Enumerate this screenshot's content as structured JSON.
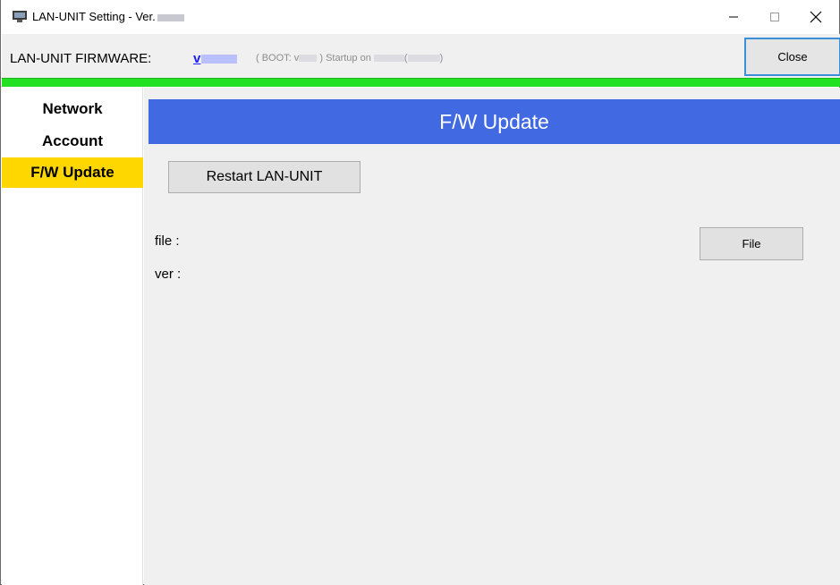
{
  "window": {
    "title": "LAN-UNIT Setting - Ver.",
    "minimize_glyph": "—",
    "maximize_glyph": "☐",
    "close_glyph": "✕"
  },
  "header": {
    "firmware_label": "LAN-UNIT FIRMWARE:",
    "firmware_version": "v",
    "boot_prefix": "( BOOT: v",
    "boot_suffix": ") Startup on",
    "boot_paren_open": "(",
    "boot_paren_close": ")",
    "close_label": "Close"
  },
  "sidebar": {
    "items": [
      {
        "label": "Network",
        "active": false
      },
      {
        "label": "Account",
        "active": false
      },
      {
        "label": "F/W Update",
        "active": true
      }
    ]
  },
  "main": {
    "title": "F/W Update",
    "restart_label": "Restart LAN-UNIT",
    "file_label": "file :",
    "ver_label": "ver :",
    "file_button_label": "File"
  },
  "colors": {
    "title_banner": "#4169e1",
    "active_nav": "#ffd700",
    "status_strip": "#22e022",
    "link": "#1a1aff"
  },
  "icons": {
    "app": "lan-unit-app-icon",
    "minimize": "minimize-icon",
    "maximize": "maximize-icon",
    "close": "close-icon"
  }
}
